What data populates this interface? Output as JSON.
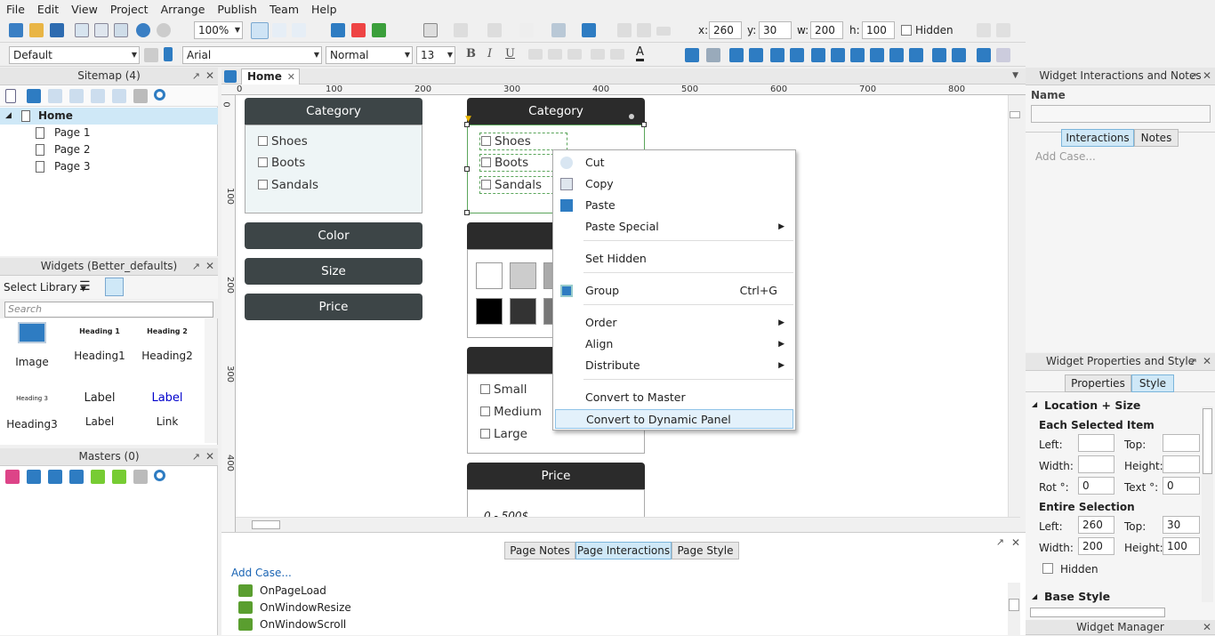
{
  "menu": [
    "File",
    "Edit",
    "View",
    "Project",
    "Arrange",
    "Publish",
    "Team",
    "Help"
  ],
  "toolbar": {
    "zoom": "100%",
    "x_label": "x:",
    "x": "260",
    "y_label": "y:",
    "y": "30",
    "w_label": "w:",
    "w": "200",
    "h_label": "h:",
    "h": "100",
    "hidden_label": "Hidden",
    "style": "Default",
    "font": "Arial",
    "weight": "Normal",
    "size": "13"
  },
  "sitemap": {
    "title": "Sitemap (4)",
    "pages": [
      "Home",
      "Page 1",
      "Page 2",
      "Page 3"
    ]
  },
  "widgets": {
    "title": "Widgets (Better_defaults)",
    "library_label": "Select Library",
    "search_placeholder": "Search",
    "items": [
      {
        "name": "Image",
        "preview": ""
      },
      {
        "name": "Heading1",
        "preview": "Heading 1"
      },
      {
        "name": "Heading2",
        "preview": "Heading 2"
      },
      {
        "name": "Heading3",
        "preview": "Heading 3"
      },
      {
        "name": "Label",
        "preview": "Label"
      },
      {
        "name": "Link",
        "preview": "Label"
      }
    ]
  },
  "masters": {
    "title": "Masters (0)"
  },
  "tab": {
    "title": "Home"
  },
  "ruler": {
    "h": [
      "0",
      "100",
      "200",
      "300",
      "400",
      "500",
      "600",
      "700",
      "800"
    ],
    "v": [
      "0",
      "100",
      "200",
      "300",
      "400"
    ]
  },
  "canvas": {
    "left": {
      "category": "Category",
      "items": [
        "Shoes",
        "Boots",
        "Sandals"
      ],
      "color": "Color",
      "size": "Size",
      "price": "Price"
    },
    "right": {
      "category": "Category",
      "items": [
        "Shoes",
        "Boots",
        "Sandals"
      ],
      "color_partial": "C",
      "size_partial": "S",
      "sizes": [
        "Small",
        "Medium",
        "Large"
      ],
      "price": "Price",
      "price_partial": "0 - 500$"
    }
  },
  "context_menu": {
    "items": [
      {
        "label": "Cut",
        "icon": "scissors-icon"
      },
      {
        "label": "Copy",
        "icon": "copy-icon"
      },
      {
        "label": "Paste",
        "icon": "paste-icon"
      },
      {
        "label": "Paste Special",
        "submenu": true
      },
      {
        "label": "Set Hidden"
      },
      {
        "label": "Group",
        "icon": "group-icon",
        "shortcut": "Ctrl+G"
      },
      {
        "label": "Order",
        "submenu": true
      },
      {
        "label": "Align",
        "submenu": true
      },
      {
        "label": "Distribute",
        "submenu": true
      },
      {
        "label": "Convert to Master"
      },
      {
        "label": "Convert to Dynamic Panel"
      }
    ]
  },
  "bottom": {
    "tabs": [
      "Page Notes",
      "Page Interactions",
      "Page Style"
    ],
    "add_case": "Add Case...",
    "events": [
      "OnPageLoad",
      "OnWindowResize",
      "OnWindowScroll"
    ]
  },
  "interactions": {
    "title": "Widget Interactions and Notes",
    "name_label": "Name",
    "tabs": [
      "Interactions",
      "Notes"
    ],
    "add_case": "Add Case..."
  },
  "props": {
    "title": "Widget Properties and Style",
    "tabs": [
      "Properties",
      "Style"
    ],
    "section": "Location + Size",
    "each": "Each Selected Item",
    "left": "Left:",
    "top": "Top:",
    "width": "Width:",
    "height": "Height:",
    "rot": "Rot °:",
    "rot_val": "0",
    "text": "Text °:",
    "text_val": "0",
    "entire": "Entire Selection",
    "e_left": "260",
    "e_top": "30",
    "e_width": "200",
    "e_height": "100",
    "hidden": "Hidden",
    "base_style": "Base Style"
  },
  "widget_manager": "Widget Manager"
}
